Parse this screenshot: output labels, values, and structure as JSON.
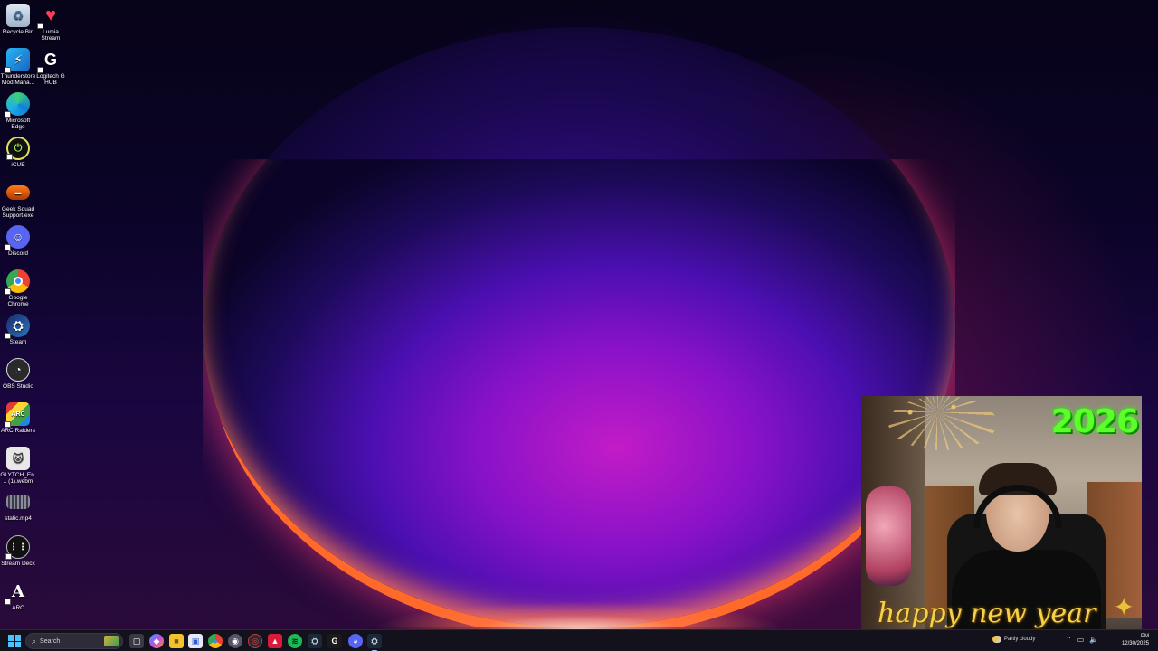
{
  "desktop": {
    "icons": [
      {
        "label": "Recycle Bin",
        "icon": "recycle-bin-icon"
      },
      {
        "label": "Lumia Stream",
        "icon": "lumia-stream-icon"
      },
      {
        "label": "Thunderstore Mod Mana...",
        "icon": "thunderstore-icon"
      },
      {
        "label": "Logitech G HUB",
        "icon": "logitech-ghub-icon"
      },
      {
        "label": "Microsoft Edge",
        "icon": "edge-icon"
      },
      {
        "label": "iCUE",
        "icon": "icue-icon"
      },
      {
        "label": "Geek Squad Support.exe",
        "icon": "geek-squad-icon"
      },
      {
        "label": "Discord",
        "icon": "discord-icon"
      },
      {
        "label": "Google Chrome",
        "icon": "chrome-icon"
      },
      {
        "label": "Steam",
        "icon": "steam-icon"
      },
      {
        "label": "OBS Studio",
        "icon": "obs-icon"
      },
      {
        "label": "ARC Raiders",
        "icon": "arc-raiders-icon"
      },
      {
        "label": "GLYTCH_En... (1).webm",
        "icon": "webm-file-icon"
      },
      {
        "label": "static.mp4",
        "icon": "video-file-icon"
      },
      {
        "label": "Stream Deck",
        "icon": "stream-deck-icon"
      },
      {
        "label": "ARC",
        "icon": "arc-icon"
      }
    ]
  },
  "webcam_overlay": {
    "year": "2026",
    "greeting": "happy new year"
  },
  "taskbar": {
    "search_placeholder": "Search",
    "apps": [
      {
        "name": "file-explorer-app",
        "glyph": "▢"
      },
      {
        "name": "copilot-app",
        "glyph": "◆"
      },
      {
        "name": "folder-app",
        "glyph": "■"
      },
      {
        "name": "store-app",
        "glyph": "▣"
      },
      {
        "name": "chrome-app",
        "glyph": "●"
      },
      {
        "name": "media-app",
        "glyph": "◉"
      },
      {
        "name": "ship-app",
        "glyph": "◎"
      },
      {
        "name": "red-app",
        "glyph": "▲"
      },
      {
        "name": "spotify-app",
        "glyph": "≋"
      },
      {
        "name": "steam-app",
        "glyph": "⛭"
      },
      {
        "name": "ghub-app",
        "glyph": "G"
      },
      {
        "name": "discord-app",
        "glyph": "◕"
      },
      {
        "name": "steam-active-app",
        "glyph": "⛭"
      }
    ],
    "weather": "Partly cloudy",
    "clock_ampm": "PM",
    "clock_date": "12/30/2025"
  },
  "colors": {
    "accent": "#4cc2ff",
    "year_green": "#5cff2a",
    "greeting_gold": "#f4d34a"
  }
}
